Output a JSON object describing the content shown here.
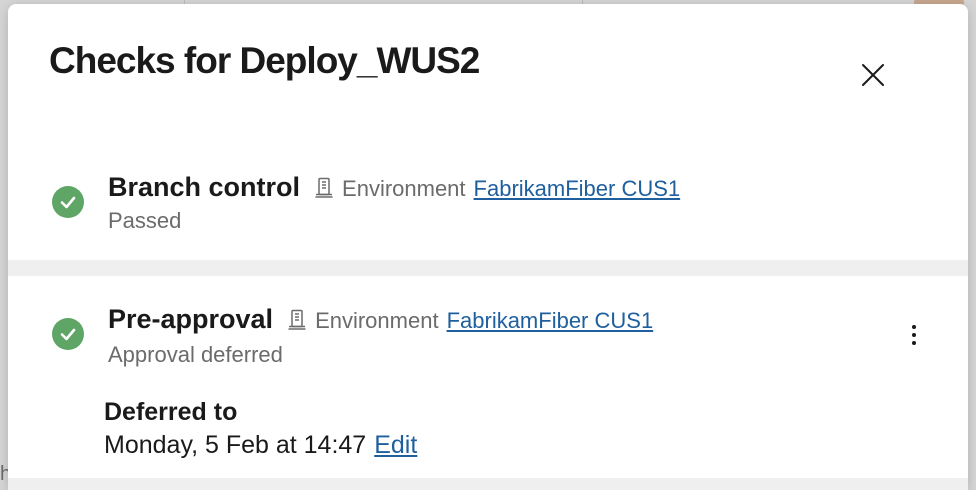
{
  "background": {
    "partial_text": "h s"
  },
  "dialog": {
    "title": "Checks for Deploy_WUS2",
    "close_icon": "close-icon"
  },
  "checks": [
    {
      "name": "Branch control",
      "icon": "check-circle-icon",
      "resource_icon": "environment-icon",
      "resource_type": "Environment",
      "resource_link": "FabrikamFiber CUS1",
      "status": "Passed"
    },
    {
      "name": "Pre-approval",
      "icon": "check-circle-icon",
      "resource_icon": "environment-icon",
      "resource_type": "Environment",
      "resource_link": "FabrikamFiber CUS1",
      "status": "Approval deferred",
      "more_icon": "more-vertical-icon",
      "deferred_label": "Deferred to",
      "deferred_value": "Monday, 5 Feb at 14:47",
      "edit_label": "Edit"
    }
  ],
  "colors": {
    "success": "#5fa565",
    "link": "#1f5f9e",
    "text": "#1a1a1a",
    "secondary_text": "#6b6b6b",
    "divider": "#efefef"
  }
}
